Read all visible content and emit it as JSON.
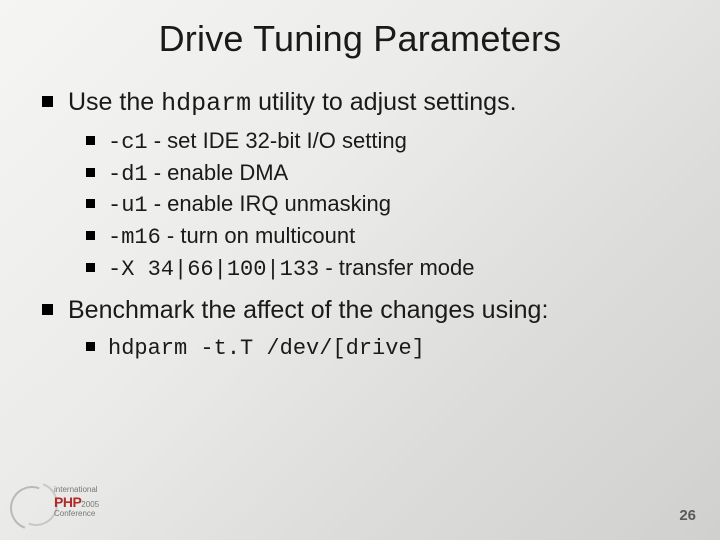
{
  "title": "Drive Tuning Parameters",
  "bullets": [
    {
      "prefix": "Use the ",
      "code": "hdparm",
      "suffix": " utility to adjust settings.",
      "sub": [
        {
          "code": "-c1",
          "text": " - set IDE 32-bit I/O setting"
        },
        {
          "code": "-d1",
          "text": " - enable DMA"
        },
        {
          "code": "-u1",
          "text": " - enable IRQ unmasking"
        },
        {
          "code": "-m16",
          "text": " - turn on multicount"
        },
        {
          "code": "-X 34|66|100|133",
          "text": " - transfer mode"
        }
      ]
    },
    {
      "prefix": "Benchmark the affect of the changes using:",
      "code": "",
      "suffix": "",
      "sub": [
        {
          "code": "hdparm -t.T /dev/[drive]",
          "text": ""
        }
      ]
    }
  ],
  "page_number": "26",
  "logo": {
    "line1": "international",
    "brand": "PHP",
    "year": "2005",
    "line3": "Conference"
  }
}
